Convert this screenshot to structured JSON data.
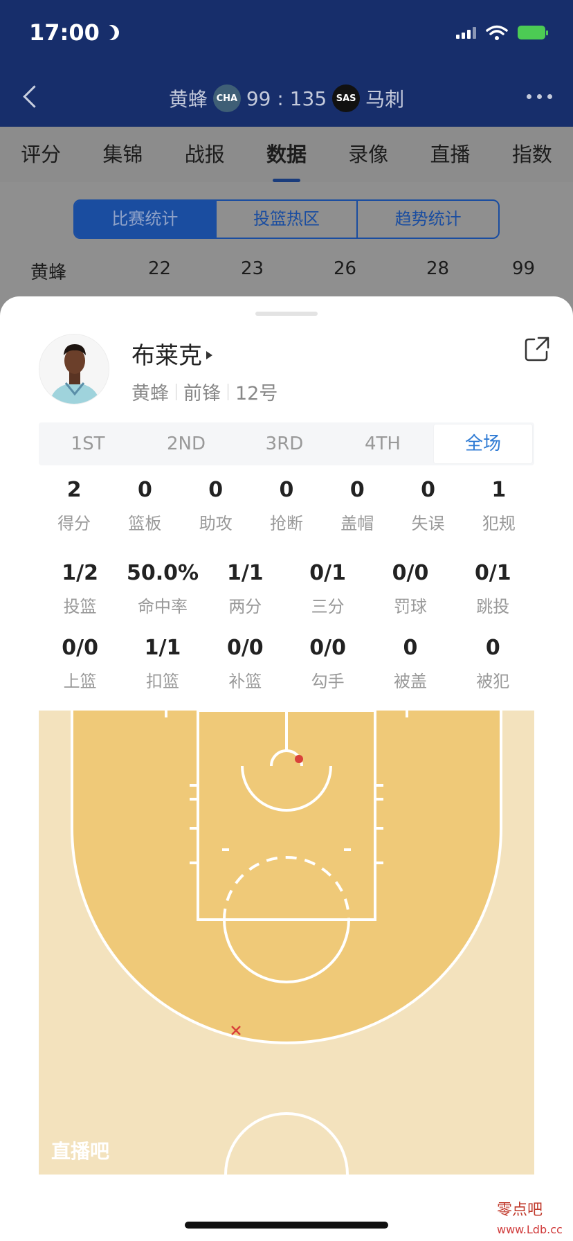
{
  "status_bar": {
    "time": "17:00"
  },
  "header": {
    "home_team": "黄蜂",
    "home_logo": "CHA",
    "score": "99 : 135",
    "away_logo": "SAS",
    "away_team": "马刺"
  },
  "tabs": [
    {
      "label": "评分"
    },
    {
      "label": "集锦"
    },
    {
      "label": "战报"
    },
    {
      "label": "数据"
    },
    {
      "label": "录像"
    },
    {
      "label": "直播"
    },
    {
      "label": "指数"
    }
  ],
  "segments": [
    {
      "label": "比赛统计"
    },
    {
      "label": "投篮热区"
    },
    {
      "label": "趋势统计"
    }
  ],
  "quarter_row": {
    "team": "黄蜂",
    "scores": [
      "22",
      "23",
      "26",
      "28",
      "99"
    ]
  },
  "player": {
    "name": "布莱克",
    "team": "黄蜂",
    "position": "前锋",
    "number": "12号"
  },
  "periods": [
    {
      "label": "1ST"
    },
    {
      "label": "2ND"
    },
    {
      "label": "3RD"
    },
    {
      "label": "4TH"
    },
    {
      "label": "全场"
    }
  ],
  "stats_row1": [
    {
      "value": "2",
      "label": "得分"
    },
    {
      "value": "0",
      "label": "篮板"
    },
    {
      "value": "0",
      "label": "助攻"
    },
    {
      "value": "0",
      "label": "抢断"
    },
    {
      "value": "0",
      "label": "盖帽"
    },
    {
      "value": "0",
      "label": "失误"
    },
    {
      "value": "1",
      "label": "犯规"
    }
  ],
  "stats_row2": [
    {
      "value": "1/2",
      "label": "投篮"
    },
    {
      "value": "50.0%",
      "label": "命中率"
    },
    {
      "value": "1/1",
      "label": "两分"
    },
    {
      "value": "0/1",
      "label": "三分"
    },
    {
      "value": "0/0",
      "label": "罚球"
    },
    {
      "value": "0/1",
      "label": "跳投"
    }
  ],
  "stats_row3": [
    {
      "value": "0/0",
      "label": "上篮"
    },
    {
      "value": "1/1",
      "label": "扣篮"
    },
    {
      "value": "0/0",
      "label": "补篮"
    },
    {
      "value": "0/0",
      "label": "勾手"
    },
    {
      "value": "0",
      "label": "被盖"
    },
    {
      "value": "0",
      "label": "被犯"
    }
  ],
  "court": {
    "brand": "直播吧",
    "colors": {
      "paint": "#efc978",
      "floor": "#f3e2bd",
      "lines": "#ffffff",
      "made": "#d9413a",
      "missed": "#d9413a"
    }
  },
  "watermark": {
    "line1": "零点吧",
    "line2": "www.Ldb.cc"
  }
}
